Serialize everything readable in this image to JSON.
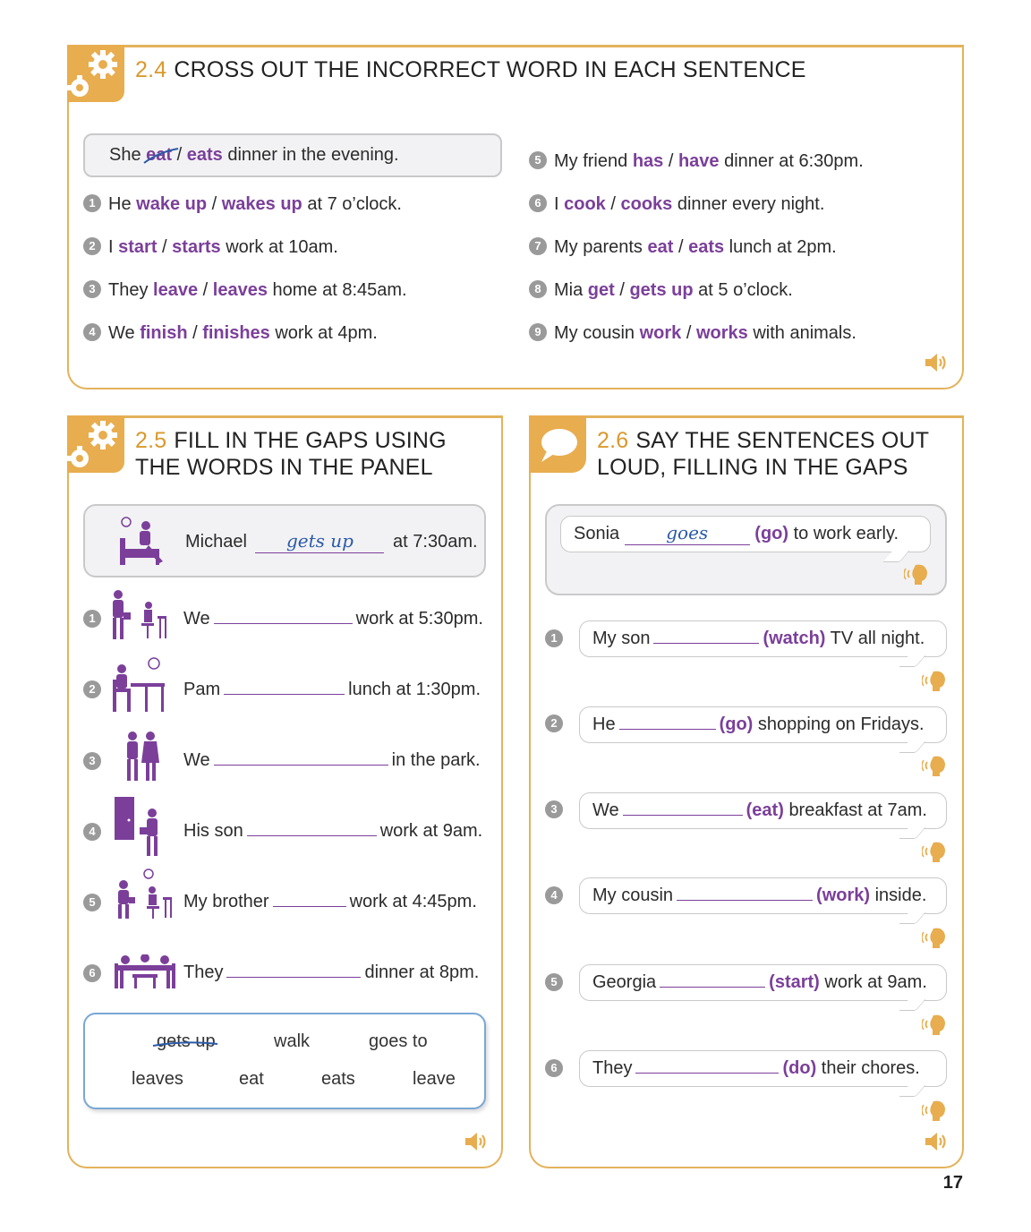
{
  "ex24": {
    "number": "2.4",
    "title": "CROSS OUT THE INCORRECT WORD IN EACH SENTENCE",
    "example": {
      "pre": "She",
      "opt1": "eat",
      "sep": "/",
      "opt2": "eats",
      "post": "dinner in the evening."
    },
    "items": [
      {
        "n": "1",
        "pre": "He",
        "opt1": "wake up",
        "opt2": "wakes up",
        "post": "at 7 o’clock."
      },
      {
        "n": "2",
        "pre": "I",
        "opt1": "start",
        "opt2": "starts",
        "post": "work at 10am."
      },
      {
        "n": "3",
        "pre": "They",
        "opt1": "leave",
        "opt2": "leaves",
        "post": "home at 8:45am."
      },
      {
        "n": "4",
        "pre": "We",
        "opt1": "finish",
        "opt2": "finishes",
        "post": "work at 4pm."
      },
      {
        "n": "5",
        "pre": "My friend",
        "opt1": "has",
        "opt2": "have",
        "post": "dinner at 6:30pm."
      },
      {
        "n": "6",
        "pre": "I",
        "opt1": "cook",
        "opt2": "cooks",
        "post": "dinner every night."
      },
      {
        "n": "7",
        "pre": "My parents",
        "opt1": "eat",
        "opt2": "eats",
        "post": "lunch at 2pm."
      },
      {
        "n": "8",
        "pre": "Mia",
        "opt1": "get",
        "opt2": "gets up",
        "post": "at 5 o’clock."
      },
      {
        "n": "9",
        "pre": "My cousin",
        "opt1": "work",
        "opt2": "works",
        "post": "with animals."
      }
    ]
  },
  "ex25": {
    "number": "2.5",
    "title_line1": "FILL IN THE GAPS USING",
    "title_line2": "THE WORDS IN THE PANEL",
    "example": {
      "pre": "Michael",
      "answer": "gets up",
      "post": "at 7:30am."
    },
    "items": [
      {
        "n": "1",
        "pre": "We",
        "post": "work at 5:30pm."
      },
      {
        "n": "2",
        "pre": "Pam",
        "post": "lunch at 1:30pm."
      },
      {
        "n": "3",
        "pre": "We",
        "post": "in the park."
      },
      {
        "n": "4",
        "pre": "His son",
        "post": "work at 9am."
      },
      {
        "n": "5",
        "pre": "My brother",
        "post": "work at 4:45pm."
      },
      {
        "n": "6",
        "pre": "They",
        "post": "dinner at 8pm."
      }
    ],
    "panel_words": [
      "gets up",
      "walk",
      "goes to",
      "leaves",
      "eat",
      "eats",
      "leave"
    ]
  },
  "ex26": {
    "number": "2.6",
    "title_line1": "SAY THE SENTENCES OUT",
    "title_line2": "LOUD, FILLING IN THE GAPS",
    "example": {
      "pre": "Sonia",
      "answer": "goes",
      "verb": "(go)",
      "post": "to work early."
    },
    "items": [
      {
        "n": "1",
        "pre": "My son",
        "verb": "(watch)",
        "post": "TV all night."
      },
      {
        "n": "2",
        "pre": "He",
        "verb": "(go)",
        "post": "shopping on Fridays."
      },
      {
        "n": "3",
        "pre": "We",
        "verb": "(eat)",
        "post": "breakfast at 7am."
      },
      {
        "n": "4",
        "pre": "My cousin",
        "verb": "(work)",
        "post": "inside."
      },
      {
        "n": "5",
        "pre": "Georgia",
        "verb": "(start)",
        "post": "work at 9am."
      },
      {
        "n": "6",
        "pre": "They",
        "verb": "(do)",
        "post": "their chores."
      }
    ]
  },
  "page_number": "17",
  "colors": {
    "accent": "#e8ad4f",
    "purple": "#7b3f9a",
    "handwriting": "#2a5aa8"
  },
  "icons": [
    "gear-icon",
    "speech-bubble-icon",
    "audio-speaker-icon",
    "speaking-head-icon"
  ]
}
